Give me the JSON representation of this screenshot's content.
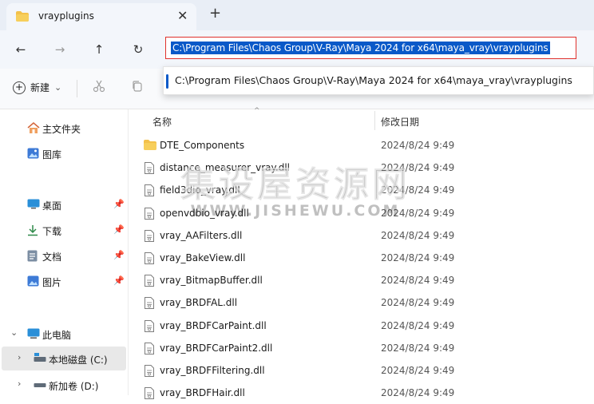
{
  "tab": {
    "title": "vrayplugins",
    "close": "✕",
    "new_tab": "+"
  },
  "nav": {
    "back": "←",
    "forward": "→",
    "up": "↑",
    "refresh": "↻"
  },
  "address": {
    "value": "C:\\Program Files\\Chaos Group\\V-Ray\\Maya 2024 for x64\\maya_vray\\vrayplugins"
  },
  "suggestion": {
    "text": "C:\\Program Files\\Chaos Group\\V-Ray\\Maya 2024 for x64\\maya_vray\\vrayplugins"
  },
  "toolbar": {
    "new_label": "新建",
    "new_chevron": "⌄"
  },
  "sidebar": {
    "items": [
      {
        "label": "主文件夹"
      },
      {
        "label": "图库"
      },
      {
        "label": "桌面"
      },
      {
        "label": "下载"
      },
      {
        "label": "文档"
      },
      {
        "label": "图片"
      },
      {
        "label": "此电脑"
      },
      {
        "label": "本地磁盘 (C:)"
      },
      {
        "label": "新加卷 (D:)"
      }
    ]
  },
  "columns": {
    "name": "名称",
    "date": "修改日期"
  },
  "files": [
    {
      "name": "DTE_Components",
      "date": "2024/8/24 9:49",
      "type": "folder"
    },
    {
      "name": "distance_measurer_vray.dll",
      "date": "2024/8/24 9:49",
      "type": "file"
    },
    {
      "name": "field3dio_vray.dll",
      "date": "2024/8/24 9:49",
      "type": "file"
    },
    {
      "name": "openvdbio_vray.dll",
      "date": "2024/8/24 9:49",
      "type": "file"
    },
    {
      "name": "vray_AAFilters.dll",
      "date": "2024/8/24 9:49",
      "type": "file"
    },
    {
      "name": "vray_BakeView.dll",
      "date": "2024/8/24 9:49",
      "type": "file"
    },
    {
      "name": "vray_BitmapBuffer.dll",
      "date": "2024/8/24 9:49",
      "type": "file"
    },
    {
      "name": "vray_BRDFAL.dll",
      "date": "2024/8/24 9:49",
      "type": "file"
    },
    {
      "name": "vray_BRDFCarPaint.dll",
      "date": "2024/8/24 9:49",
      "type": "file"
    },
    {
      "name": "vray_BRDFCarPaint2.dll",
      "date": "2024/8/24 9:49",
      "type": "file"
    },
    {
      "name": "vray_BRDFFiltering.dll",
      "date": "2024/8/24 9:49",
      "type": "file"
    },
    {
      "name": "vray_BRDFHair.dll",
      "date": "2024/8/24 9:49",
      "type": "file"
    }
  ],
  "watermark": {
    "big": "集设屋资源网",
    "small": "WWW.JISHEWU.COM"
  },
  "colors": {
    "accent": "#0a59c8",
    "folder": "#f3c14b",
    "address_border": "#e0312c"
  }
}
